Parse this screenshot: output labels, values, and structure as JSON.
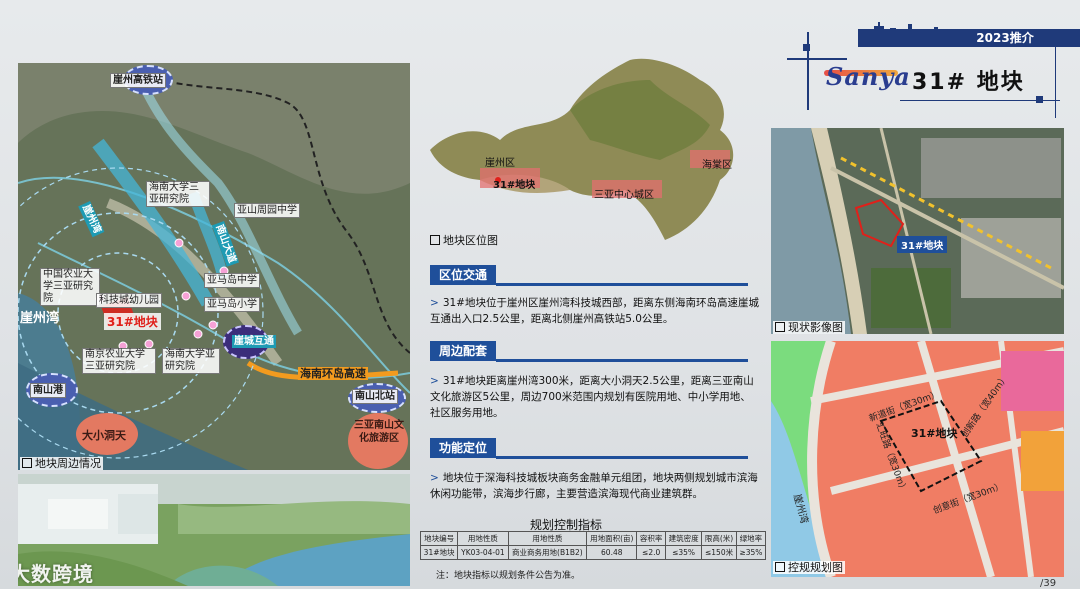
{
  "header": {
    "tag": "2023推介",
    "brand": "Sanya",
    "plot_title": "31# 地块"
  },
  "left_map": {
    "caption": "地块周边情况",
    "labels": {
      "rail_station": "崖州高铁站",
      "plot": "31#地块",
      "hainan_univ": "海南大学三亚研究院",
      "middle_school": "亚山周园中学",
      "road_west": "崖州湾",
      "road_east": "南山大道",
      "china_agri": "中国农业大学三亚研究院",
      "kindergarten": "科技城幼儿园",
      "primary": "亚马岛中学",
      "primary2": "亚马岛小学",
      "nanjing_agri": "南京农业大学三亚研究院",
      "hainan_uni2": "海南大学亚研究院",
      "yazhou_bay": "崖州湾",
      "interchange": "崖城互通",
      "ring_highway": "海南环岛高速",
      "nanshan_port": "南山港",
      "nanshan_north": "南山北站",
      "daxiao_dongtian": "大小洞天",
      "nanshan_culture": "三亚南山文化旅游区"
    }
  },
  "render": {},
  "location_map": {
    "caption": "地块区位图",
    "labels": {
      "yazhou": "崖州区",
      "plot": "31#地块",
      "city": "三亚中心城区",
      "haitang": "海棠区"
    }
  },
  "sections": [
    {
      "heading": "区位交通",
      "text": "31#地块位于崖州区崖州湾科技城西部，距离东侧海南环岛高速崖城互通出入口2.5公里，距离北侧崖州高铁站5.0公里。"
    },
    {
      "heading": "周边配套",
      "text": "31#地块距离崖州湾300米，距离大小洞天2.5公里，距离三亚南山文化旅游区5公里，周边700米范围内规划有医院用地、中小学用地、社区服务用地。"
    },
    {
      "heading": "功能定位",
      "text": "地块位于深海科技城板块商务金融单元组团，地块两侧规划城市滨海休闲功能带，滨海步行廊，主要营造滨海现代商业建筑群。"
    }
  ],
  "control_table": {
    "title": "规划控制指标",
    "headers": [
      "地块编号",
      "用地性质",
      "用地性质",
      "用地面积(亩)",
      "容积率",
      "建筑密度",
      "限高(米)",
      "绿地率"
    ],
    "rows": [
      [
        "31#地块",
        "YK03-04-01",
        "商业商务用地(B1B2)",
        "60.48",
        "≤2.0",
        "≤35%",
        "≤150米",
        "≥35%"
      ]
    ],
    "note": "注：地块指标以规划条件公告为准。"
  },
  "aerial": {
    "caption": "现状影像图",
    "plot_label": "31#地块"
  },
  "control_plan": {
    "caption": "控规规划图",
    "plot_label": "31#地块",
    "roads": {
      "north": "新道街（宽30m）",
      "east": "创新路（宽40m）",
      "west": "汇旺路（宽30m）",
      "south": "创意街（宽30m）",
      "bay": "崖州湾"
    }
  },
  "watermark": "大数跨境",
  "page_number": "/39",
  "colors": {
    "brand_blue": "#1f4f9a",
    "accent_red": "#e0201a",
    "orange": "#f29b1f"
  }
}
